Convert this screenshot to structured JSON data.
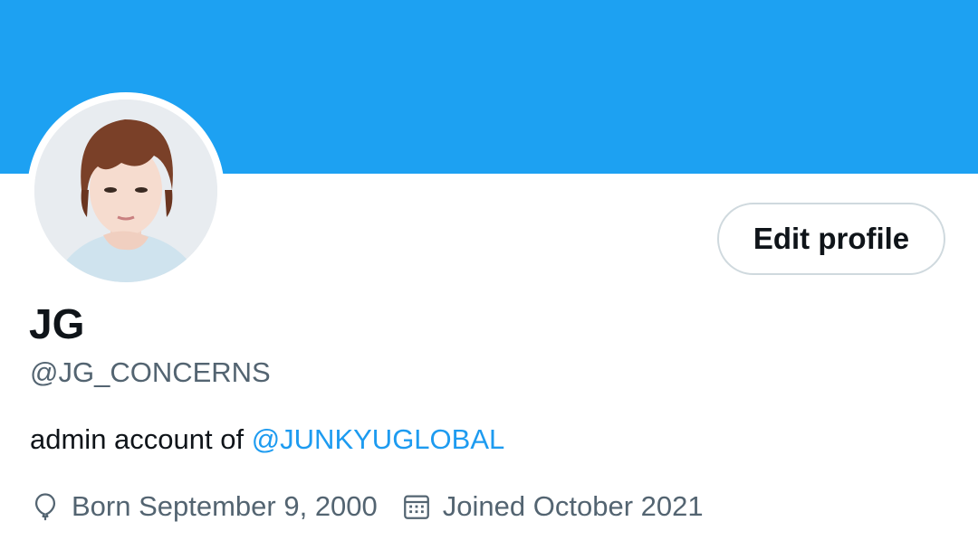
{
  "header": {
    "banner_color": "#1da1f2"
  },
  "profile": {
    "display_name": "JG",
    "handle": "@JG_CONCERNS",
    "edit_button_label": "Edit profile",
    "bio": {
      "text_prefix": "admin account of ",
      "mention": "@JUNKYUGLOBAL"
    },
    "born": "Born September 9, 2000",
    "joined": "Joined October 2021",
    "icons": {
      "born": "balloon-icon",
      "joined": "calendar-icon"
    }
  },
  "colors": {
    "link": "#1d9bf0",
    "secondary_text": "#536471",
    "primary_text": "#0f1419"
  }
}
